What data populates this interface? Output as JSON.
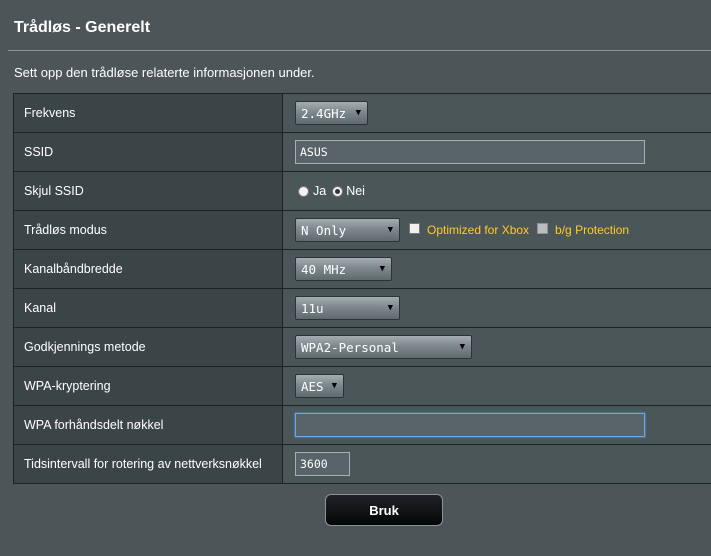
{
  "page": {
    "title": "Trådløs - Generelt",
    "description": "Sett opp den trådløse relaterte informasjonen under."
  },
  "fields": {
    "frequency": {
      "label": "Frekvens",
      "value": "2.4GHz"
    },
    "ssid": {
      "label": "SSID",
      "value": "ASUS"
    },
    "hide_ssid": {
      "label": "Skjul SSID",
      "option_yes": "Ja",
      "option_no": "Nei",
      "selected": "Nei"
    },
    "wireless_mode": {
      "label": "Trådløs modus",
      "value": "N Only",
      "xbox_label": "Optimized for Xbox",
      "xbox_checked": false,
      "bg_protection_label": "b/g Protection",
      "bg_protection_checked": false
    },
    "channel_bandwidth": {
      "label": "Kanalbåndbredde",
      "value": "40 MHz"
    },
    "channel": {
      "label": "Kanal",
      "value": "11u"
    },
    "auth_method": {
      "label": "Godkjennings metode",
      "value": "WPA2-Personal"
    },
    "wpa_encryption": {
      "label": "WPA-kryptering",
      "value": "AES"
    },
    "wpa_psk": {
      "label": "WPA forhåndsdelt nøkkel",
      "value": ""
    },
    "key_rotation": {
      "label": "Tidsintervall for rotering av nettverksnøkkel",
      "value": "3600"
    }
  },
  "actions": {
    "apply_label": "Bruk"
  },
  "colors": {
    "background": "#4d5558",
    "label_bg": "#3b4447",
    "accent_yellow": "#ffcc22"
  }
}
